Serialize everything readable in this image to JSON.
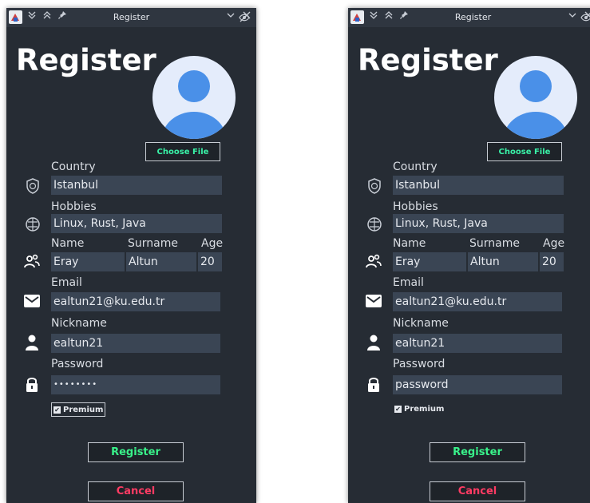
{
  "windows": [
    {
      "id": "left",
      "title": "Register",
      "heading": "Register",
      "choose_file": "Choose File",
      "labels": {
        "country": "Country",
        "hobbies": "Hobbies",
        "name": "Name",
        "surname": "Surname",
        "age": "Age",
        "email": "Email",
        "nickname": "Nickname",
        "password": "Password"
      },
      "values": {
        "country": "Istanbul",
        "hobbies": "Linux, Rust, Java",
        "name": "Eray",
        "surname": "Altun",
        "age": "20",
        "email": "ealtun21@ku.edu.tr",
        "nickname": "ealtun21",
        "password": "••••••••"
      },
      "password_visible": false,
      "premium": {
        "label": "Premium",
        "checked": true
      },
      "register_label": "Register",
      "cancel_label": "Cancel"
    },
    {
      "id": "right",
      "title": "Register",
      "heading": "Register",
      "choose_file": "Choose File",
      "labels": {
        "country": "Country",
        "hobbies": "Hobbies",
        "name": "Name",
        "surname": "Surname",
        "age": "Age",
        "email": "Email",
        "nickname": "Nickname",
        "password": "Password"
      },
      "values": {
        "country": "Istanbul",
        "hobbies": "Linux, Rust, Java",
        "name": "Eray",
        "surname": "Altun",
        "age": "20",
        "email": "ealtun21@ku.edu.tr",
        "nickname": "ealtun21",
        "password": "password"
      },
      "password_visible": true,
      "premium": {
        "label": "Premium",
        "checked": true
      },
      "register_label": "Register",
      "cancel_label": "Cancel"
    }
  ],
  "titlebar_glyphs": {
    "minimize_all": "≫",
    "maximize_all": "≪",
    "pin": "✎",
    "dropdown": "⌄",
    "close": "✕"
  },
  "colors": {
    "window_bg": "#262c34",
    "field_bg": "#3a4554",
    "register_text": "#39f28a",
    "cancel_text": "#ff3b63",
    "choose_text": "#39f2a7",
    "avatar_blue": "#4a90e8"
  }
}
